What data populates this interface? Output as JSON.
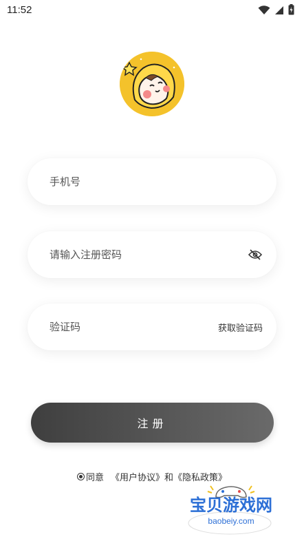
{
  "status_bar": {
    "time": "11:52",
    "icons": [
      "wifi-icon",
      "cellular-signal-icon",
      "battery-charging-icon"
    ]
  },
  "avatar": {
    "icon": "cartoon-character-avatar",
    "background_color": "#f4c22b"
  },
  "form": {
    "phone_placeholder": "手机号",
    "password_placeholder": "请输入注册密码",
    "password_toggle_icon": "eye-hidden-icon",
    "code_placeholder": "验证码",
    "get_code_label": "获取验证码"
  },
  "register_button": {
    "label": "注册"
  },
  "agreement": {
    "agree_label": "同意",
    "user_agreement": "《用户协议》",
    "and": "和",
    "privacy_policy": "《隐私政策》"
  },
  "watermark": {
    "title": "宝贝游戏网",
    "url": "baobeiy.com"
  },
  "colors": {
    "button_start": "#3f3f3f",
    "button_end": "#6a6a6a",
    "watermark_blue": "#2c6fd6",
    "avatar_yellow": "#f4c22b"
  }
}
